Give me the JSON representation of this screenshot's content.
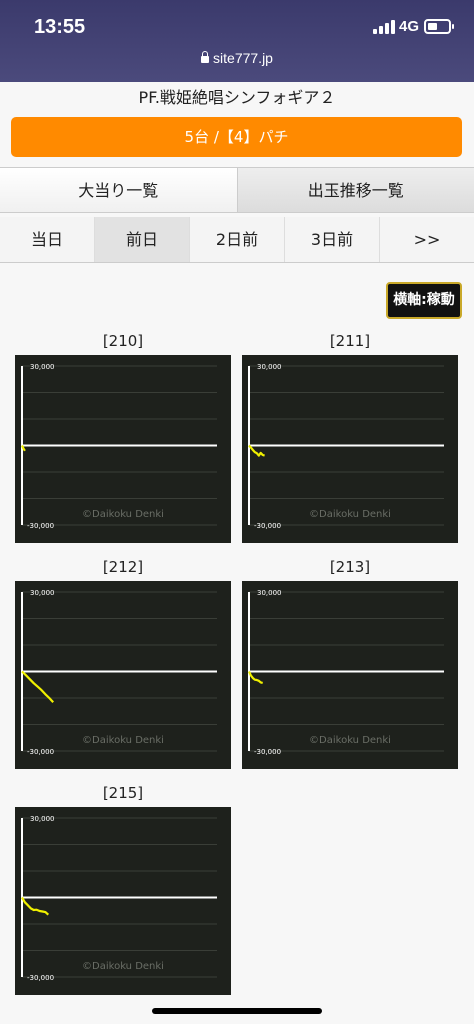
{
  "status": {
    "time": "13:55",
    "network": "4G",
    "battery_level": 0.45
  },
  "browser": {
    "url": "site777.jp"
  },
  "page": {
    "title": "PF.戦姫絶唱シンフォギア２",
    "banner": "5台 /【4】パチ",
    "tabs": [
      {
        "label": "大当り一覧"
      },
      {
        "label": "出玉推移一覧"
      }
    ],
    "days": [
      {
        "label": "当日"
      },
      {
        "label": "前日",
        "active": true
      },
      {
        "label": "2日前"
      },
      {
        "label": "3日前"
      },
      {
        "label": ">>"
      }
    ],
    "axis_button": "横軸:稼動"
  },
  "chart_data": [
    {
      "type": "line",
      "title": "[210]",
      "ylim": [
        -30000,
        30000
      ],
      "yticks": [
        "30,000",
        "-30,000"
      ],
      "watermark": "©Daikoku Denki",
      "line_color": "#f0f000",
      "x": [
        0,
        1,
        2,
        3
      ],
      "y": [
        0,
        -800,
        -1400,
        -2000
      ]
    },
    {
      "type": "line",
      "title": "[211]",
      "ylim": [
        -30000,
        30000
      ],
      "yticks": [
        "30,000",
        "-30,000"
      ],
      "watermark": "©Daikoku Denki",
      "line_color": "#f0f000",
      "x": [
        0,
        2,
        4,
        6,
        8,
        10,
        12,
        14,
        16
      ],
      "y": [
        0,
        -800,
        -1700,
        -2500,
        -2900,
        -3800,
        -2800,
        -3600,
        -3800
      ]
    },
    {
      "type": "line",
      "title": "[212]",
      "ylim": [
        -30000,
        30000
      ],
      "yticks": [
        "30,000",
        "-30,000"
      ],
      "watermark": "©Daikoku Denki",
      "line_color": "#f0f000",
      "x": [
        0,
        4,
        8,
        12,
        16,
        20,
        24,
        28,
        32
      ],
      "y": [
        0,
        -1400,
        -2900,
        -4400,
        -5700,
        -7000,
        -8600,
        -10000,
        -11600
      ]
    },
    {
      "type": "line",
      "title": "[213]",
      "ylim": [
        -30000,
        30000
      ],
      "yticks": [
        "30,000",
        "-30,000"
      ],
      "watermark": "©Daikoku Denki",
      "line_color": "#f0f000",
      "x": [
        0,
        2,
        4,
        6,
        8,
        10,
        12,
        14
      ],
      "y": [
        0,
        -1500,
        -2500,
        -3100,
        -3200,
        -3500,
        -4100,
        -4300
      ]
    },
    {
      "type": "line",
      "title": "[215]",
      "ylim": [
        -30000,
        30000
      ],
      "yticks": [
        "30,000",
        "-30,000"
      ],
      "watermark": "©Daikoku Denki",
      "line_color": "#f0f000",
      "x": [
        0,
        3,
        6,
        9,
        12,
        15,
        18,
        21,
        24,
        27
      ],
      "y": [
        0,
        -1800,
        -2900,
        -4100,
        -4700,
        -4600,
        -5100,
        -5300,
        -5500,
        -6500
      ]
    }
  ]
}
